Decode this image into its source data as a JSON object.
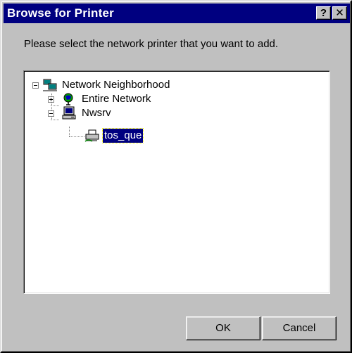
{
  "window": {
    "title": "Browse for Printer",
    "help_glyph": "?",
    "close_glyph": "✕"
  },
  "prompt": "Please select the network printer that you want to add.",
  "tree": {
    "nodes": [
      {
        "label": "Network Neighborhood",
        "icon": "network-neighborhood-icon",
        "expander": "minus"
      },
      {
        "label": "Entire Network",
        "icon": "globe-icon",
        "expander": "plus"
      },
      {
        "label": "Nwsrv",
        "icon": "computer-icon",
        "expander": "minus"
      },
      {
        "label": "tos_que",
        "icon": "printer-icon",
        "selected": true
      }
    ]
  },
  "buttons": {
    "ok": "OK",
    "cancel": "Cancel"
  },
  "colors": {
    "titlebar": "#000080",
    "face": "#c0c0c0",
    "selection": "#000080"
  }
}
